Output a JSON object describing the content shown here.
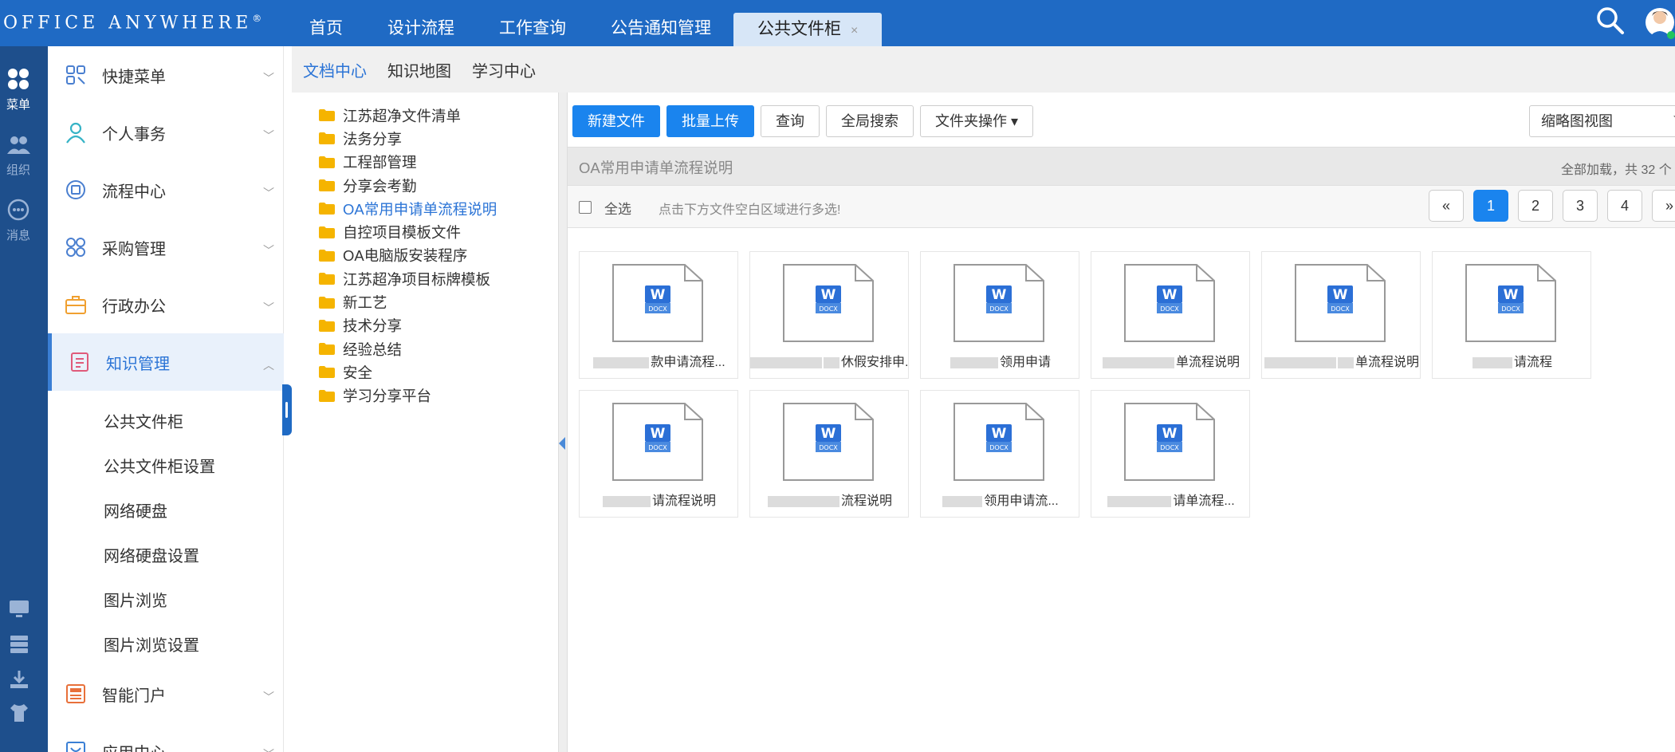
{
  "app": {
    "logo": "OFFICE ANYWHERE",
    "logo_mark": "®"
  },
  "topnav": {
    "tabs": [
      {
        "label": "首页"
      },
      {
        "label": "设计流程"
      },
      {
        "label": "工作查询"
      },
      {
        "label": "公告通知管理"
      },
      {
        "label": "公共文件柜",
        "active": true,
        "close": "×"
      }
    ]
  },
  "rail": {
    "items": [
      {
        "label": "菜单",
        "icon": "grid-icon"
      },
      {
        "label": "组织",
        "icon": "users-icon"
      },
      {
        "label": "消息",
        "icon": "chat-icon"
      }
    ]
  },
  "menu": {
    "items": [
      {
        "label": "快捷菜单",
        "icon": "shortcut-icon",
        "color": "#4a7fd0"
      },
      {
        "label": "个人事务",
        "icon": "person-icon",
        "color": "#36b3c6"
      },
      {
        "label": "流程中心",
        "icon": "flow-icon",
        "color": "#4a7fd0"
      },
      {
        "label": "采购管理",
        "icon": "purchase-icon",
        "color": "#4a7fd0"
      },
      {
        "label": "行政办公",
        "icon": "briefcase-icon",
        "color": "#f0a030"
      },
      {
        "label": "知识管理",
        "icon": "knowledge-icon",
        "color": "#e05a7a",
        "active": true
      },
      {
        "label": "智能门户",
        "icon": "portal-icon",
        "color": "#e8703a"
      },
      {
        "label": "应用中心",
        "icon": "app-icon",
        "color": "#3a7fd5"
      }
    ],
    "sub_items": [
      {
        "label": "公共文件柜"
      },
      {
        "label": "公共文件柜设置"
      },
      {
        "label": "网络硬盘"
      },
      {
        "label": "网络硬盘设置"
      },
      {
        "label": "图片浏览"
      },
      {
        "label": "图片浏览设置"
      }
    ]
  },
  "subtabs": [
    {
      "label": "文档中心",
      "active": true
    },
    {
      "label": "知识地图"
    },
    {
      "label": "学习中心"
    }
  ],
  "tree": {
    "folders": [
      {
        "label": "江苏超净文件清单"
      },
      {
        "label": "法务分享"
      },
      {
        "label": "工程部管理"
      },
      {
        "label": "分享会考勤"
      },
      {
        "label": "OA常用申请单流程说明",
        "selected": true
      },
      {
        "label": "自控项目模板文件"
      },
      {
        "label": "OA电脑版安装程序"
      },
      {
        "label": "江苏超净项目标牌模板"
      },
      {
        "label": "新工艺"
      },
      {
        "label": "技术分享"
      },
      {
        "label": "经验总结"
      },
      {
        "label": "安全"
      },
      {
        "label": "学习分享平台"
      }
    ]
  },
  "toolbar": {
    "new_file": "新建文件",
    "batch_upload": "批量上传",
    "query": "查询",
    "global_search": "全局搜索",
    "folder_ops": "文件夹操作 ▾",
    "view_mode": "缩略图视图"
  },
  "pathbar": {
    "path": "OA常用申请单流程说明",
    "loaded": "全部加载，共 32 个"
  },
  "selbar": {
    "select_all": "全选",
    "hint": "点击下方文件空白区域进行多选!"
  },
  "pager": {
    "prev": "«",
    "pages": [
      "1",
      "2",
      "3",
      "4"
    ],
    "current": "1",
    "next": "»"
  },
  "files": [
    {
      "name": "款申请流程..."
    },
    {
      "name": "休假安排申..."
    },
    {
      "name": "领用申请"
    },
    {
      "name": "单流程说明"
    },
    {
      "name": "单流程说明"
    },
    {
      "name": "请流程"
    },
    {
      "name": "请流程说明"
    },
    {
      "name": "流程说明"
    },
    {
      "name": "领用申请流..."
    },
    {
      "name": "请单流程..."
    }
  ],
  "doc_badge": "DOCX",
  "colors": {
    "topbar": "#1f6ac4",
    "rail": "#1e4f8c",
    "primary": "#1a84ee",
    "link": "#2b74d6",
    "folder": "#f5b400"
  }
}
